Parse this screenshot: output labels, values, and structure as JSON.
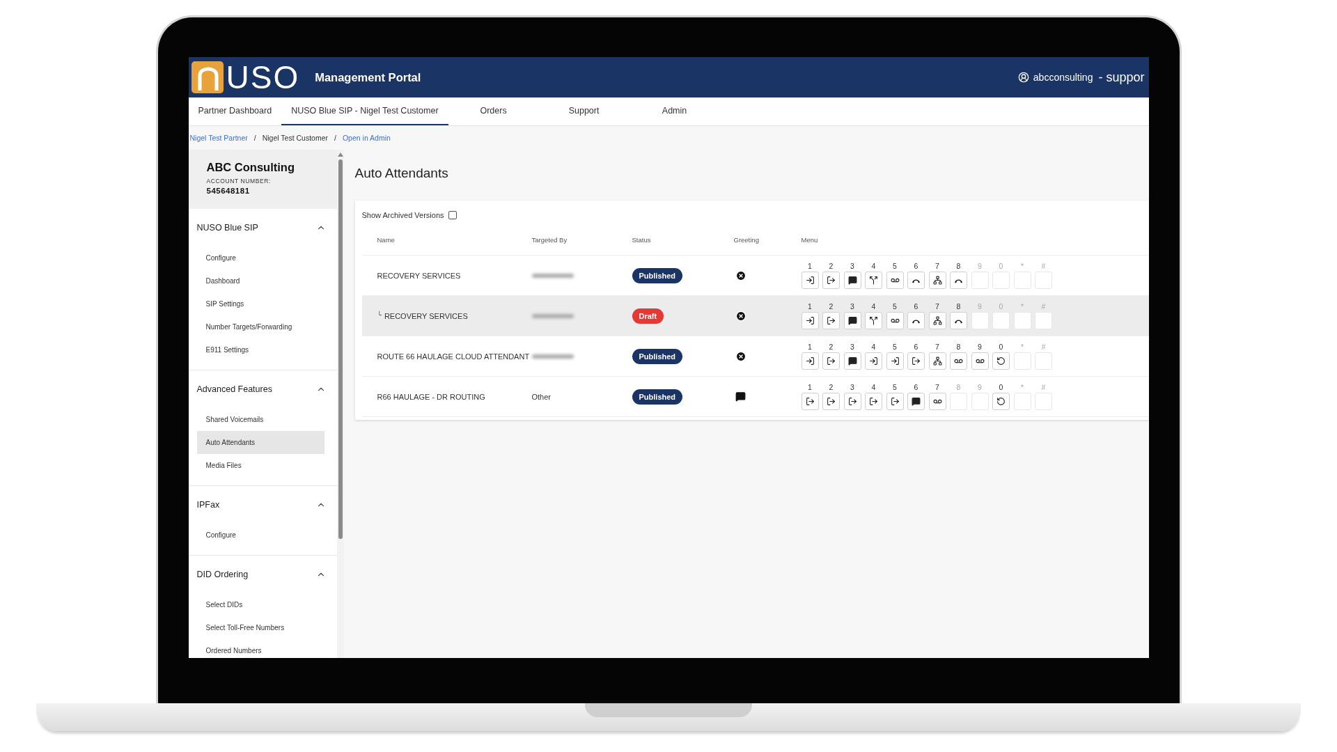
{
  "header": {
    "logo_text": "USO",
    "title": "Management Portal",
    "user": "abcconsulting",
    "role": "- suppor"
  },
  "tabs": [
    {
      "label": "Partner Dashboard",
      "selected": false
    },
    {
      "label": "NUSO Blue SIP - Nigel Test Customer",
      "selected": true
    },
    {
      "label": "Orders",
      "selected": false
    },
    {
      "label": "Support",
      "selected": false
    },
    {
      "label": "Admin",
      "selected": false
    }
  ],
  "breadcrumb": [
    {
      "label": "Nigel Test Partner",
      "kind": "link"
    },
    {
      "label": "/",
      "kind": "separator"
    },
    {
      "label": "Nigel Test Customer",
      "kind": "text"
    },
    {
      "label": "/",
      "kind": "separator"
    },
    {
      "label": "Open in Admin",
      "kind": "link"
    }
  ],
  "account": {
    "name": "ABC Consulting",
    "number_label": "ACCOUNT NUMBER:",
    "number": "545648181"
  },
  "sidebar": {
    "sections": [
      {
        "title": "NUSO Blue SIP",
        "expanded": true,
        "items": [
          {
            "label": "Configure",
            "selected": false
          },
          {
            "label": "Dashboard",
            "selected": false
          },
          {
            "label": "SIP Settings",
            "selected": false
          },
          {
            "label": "Number Targets/Forwarding",
            "selected": false
          },
          {
            "label": "E911 Settings",
            "selected": false
          }
        ]
      },
      {
        "title": "Advanced Features",
        "expanded": true,
        "items": [
          {
            "label": "Shared Voicemails",
            "selected": false
          },
          {
            "label": "Auto Attendants",
            "selected": true
          },
          {
            "label": "Media Files",
            "selected": false
          }
        ]
      },
      {
        "title": "IPFax",
        "expanded": true,
        "items": [
          {
            "label": "Configure",
            "selected": false
          }
        ]
      },
      {
        "title": "DID Ordering",
        "expanded": true,
        "items": [
          {
            "label": "Select DIDs",
            "selected": false
          },
          {
            "label": "Select Toll-Free Numbers",
            "selected": false
          },
          {
            "label": "Ordered Numbers",
            "selected": false
          }
        ]
      }
    ]
  },
  "main": {
    "title": "Auto Attendants",
    "archived_toggle": {
      "label": "Show Archived Versions",
      "checked": false
    },
    "table": {
      "columns": [
        "Name",
        "Targeted By",
        "Status",
        "Greeting",
        "Menu"
      ],
      "rows": [
        {
          "name": "RECOVERY SERVICES",
          "highlighted": false,
          "targeted_by": {
            "kind": "redacted"
          },
          "status": {
            "label": "Published",
            "kind": "published"
          },
          "greeting": {
            "kind": "none"
          },
          "keys": [
            {
              "label": "1",
              "kind": "enter"
            },
            {
              "label": "2",
              "kind": "exit"
            },
            {
              "label": "3",
              "kind": "message"
            },
            {
              "label": "4",
              "kind": "split"
            },
            {
              "label": "5",
              "kind": "voicemail"
            },
            {
              "label": "6",
              "kind": "hangup"
            },
            {
              "label": "7",
              "kind": "tree"
            },
            {
              "label": "8",
              "kind": "hangup"
            },
            {
              "label": "9",
              "kind": "empty"
            },
            {
              "label": "0",
              "kind": "empty"
            },
            {
              "label": "*",
              "kind": "empty"
            },
            {
              "label": "#",
              "kind": "empty"
            }
          ]
        },
        {
          "prefix": "└",
          "name": "RECOVERY SERVICES",
          "highlighted": true,
          "targeted_by": {
            "kind": "redacted"
          },
          "status": {
            "label": "Draft",
            "kind": "draft"
          },
          "greeting": {
            "kind": "none"
          },
          "keys": [
            {
              "label": "1",
              "kind": "enter"
            },
            {
              "label": "2",
              "kind": "exit"
            },
            {
              "label": "3",
              "kind": "message"
            },
            {
              "label": "4",
              "kind": "split"
            },
            {
              "label": "5",
              "kind": "voicemail"
            },
            {
              "label": "6",
              "kind": "hangup"
            },
            {
              "label": "7",
              "kind": "tree"
            },
            {
              "label": "8",
              "kind": "hangup"
            },
            {
              "label": "9",
              "kind": "empty"
            },
            {
              "label": "0",
              "kind": "empty"
            },
            {
              "label": "*",
              "kind": "empty"
            },
            {
              "label": "#",
              "kind": "empty"
            }
          ]
        },
        {
          "name": "ROUTE 66 HAULAGE CLOUD ATTENDANT",
          "highlighted": false,
          "targeted_by": {
            "kind": "redacted"
          },
          "status": {
            "label": "Published",
            "kind": "published"
          },
          "greeting": {
            "kind": "none"
          },
          "keys": [
            {
              "label": "1",
              "kind": "enter"
            },
            {
              "label": "2",
              "kind": "exit"
            },
            {
              "label": "3",
              "kind": "message"
            },
            {
              "label": "4",
              "kind": "enter"
            },
            {
              "label": "5",
              "kind": "enter"
            },
            {
              "label": "6",
              "kind": "exit"
            },
            {
              "label": "7",
              "kind": "tree"
            },
            {
              "label": "8",
              "kind": "voicemail"
            },
            {
              "label": "9",
              "kind": "voicemail"
            },
            {
              "label": "0",
              "kind": "restart"
            },
            {
              "label": "*",
              "kind": "empty"
            },
            {
              "label": "#",
              "kind": "empty"
            }
          ]
        },
        {
          "name": "R66 HAULAGE - DR ROUTING",
          "highlighted": false,
          "targeted_by": {
            "kind": "text",
            "text": "Other"
          },
          "status": {
            "label": "Published",
            "kind": "published"
          },
          "greeting": {
            "kind": "message"
          },
          "keys": [
            {
              "label": "1",
              "kind": "exit"
            },
            {
              "label": "2",
              "kind": "exit"
            },
            {
              "label": "3",
              "kind": "exit"
            },
            {
              "label": "4",
              "kind": "exit"
            },
            {
              "label": "5",
              "kind": "exit"
            },
            {
              "label": "6",
              "kind": "message"
            },
            {
              "label": "7",
              "kind": "voicemail"
            },
            {
              "label": "8",
              "kind": "empty"
            },
            {
              "label": "9",
              "kind": "empty"
            },
            {
              "label": "0",
              "kind": "restart"
            },
            {
              "label": "*",
              "kind": "empty"
            },
            {
              "label": "#",
              "kind": "empty"
            }
          ]
        }
      ]
    }
  }
}
